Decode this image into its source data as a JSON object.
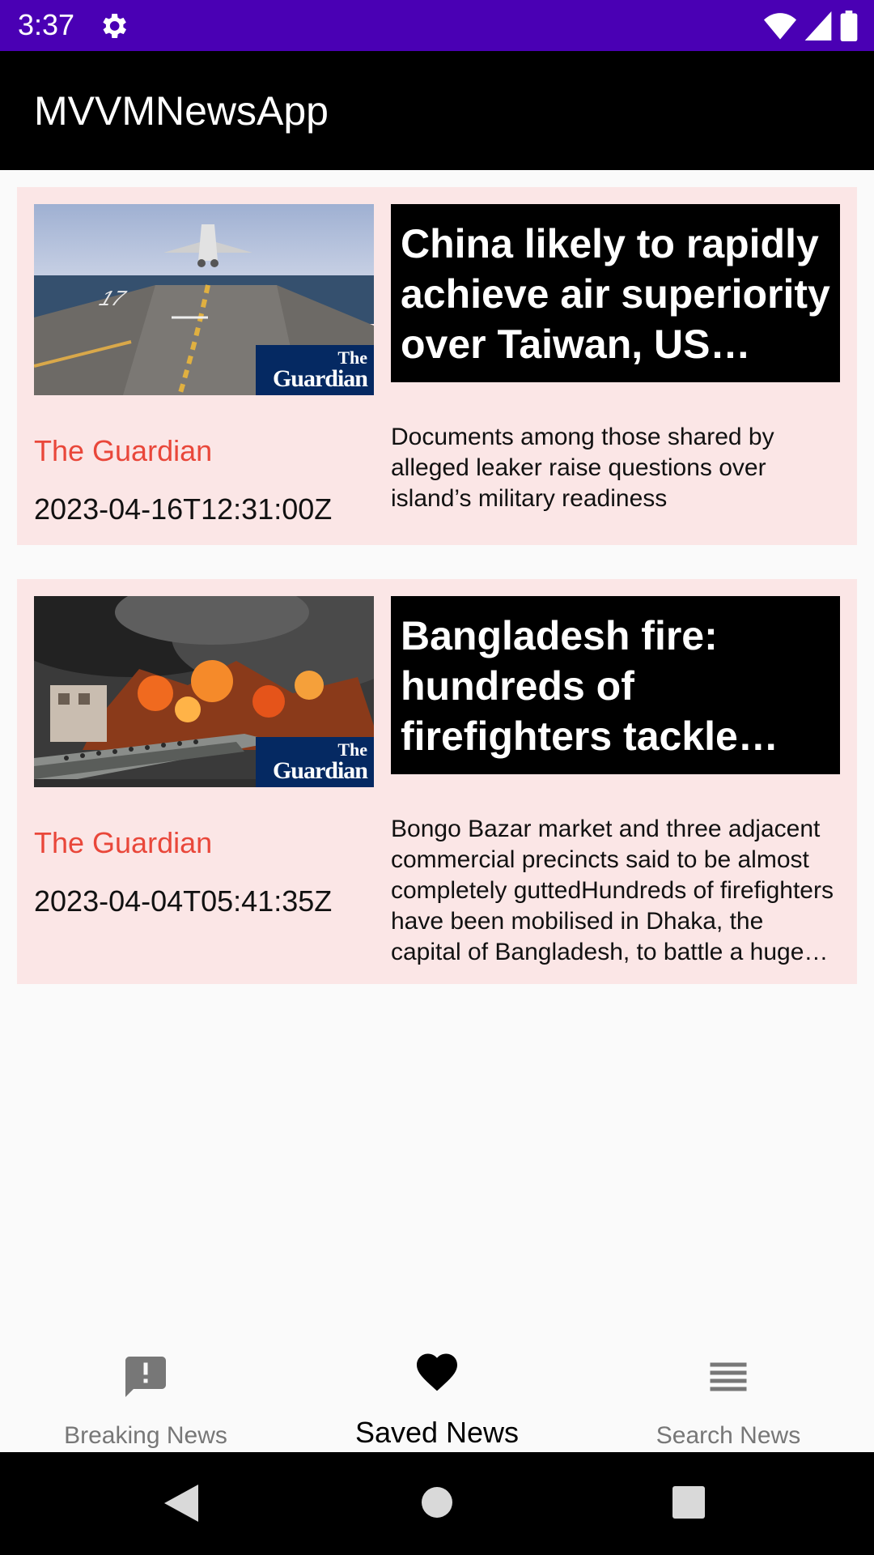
{
  "status_bar": {
    "time": "3:37",
    "icons": [
      "gear-icon",
      "wifi-icon",
      "signal-icon",
      "battery-icon"
    ]
  },
  "app_bar": {
    "title": "MVVMNewsApp"
  },
  "articles": [
    {
      "title": "China likely to rapidly achieve air superiority over Taiwan, US leaked documents say",
      "source": "The Guardian",
      "date": "2023-04-16T12:31:00Z",
      "description": "Documents among those shared by alleged leaker raise questions over island’s military readiness",
      "logo_the": "The",
      "logo_name": "Guardian"
    },
    {
      "title": "Bangladesh fire: hundreds of firefighters tackle blaze at Dhaka market",
      "source": "The Guardian",
      "date": "2023-04-04T05:41:35Z",
      "description": "Bongo Bazar market and three adjacent commercial precincts said to be almost completely guttedHundreds of firefighters have been mobilised in Dhaka, the capital of Bangladesh, to battle a huge fire",
      "logo_the": "The",
      "logo_name": "Guardian"
    }
  ],
  "bottom_nav": {
    "items": [
      {
        "label": "Breaking News",
        "icon": "announcement-icon",
        "active": false
      },
      {
        "label": "Saved News",
        "icon": "heart-icon",
        "active": true
      },
      {
        "label": "Search News",
        "icon": "list-icon",
        "active": false
      }
    ]
  },
  "colors": {
    "status_bar": "#4a00b4",
    "app_bar": "#000000",
    "card_bg": "#fbe6e6",
    "source_text": "#e9473a",
    "guardian_blue": "#052962"
  }
}
